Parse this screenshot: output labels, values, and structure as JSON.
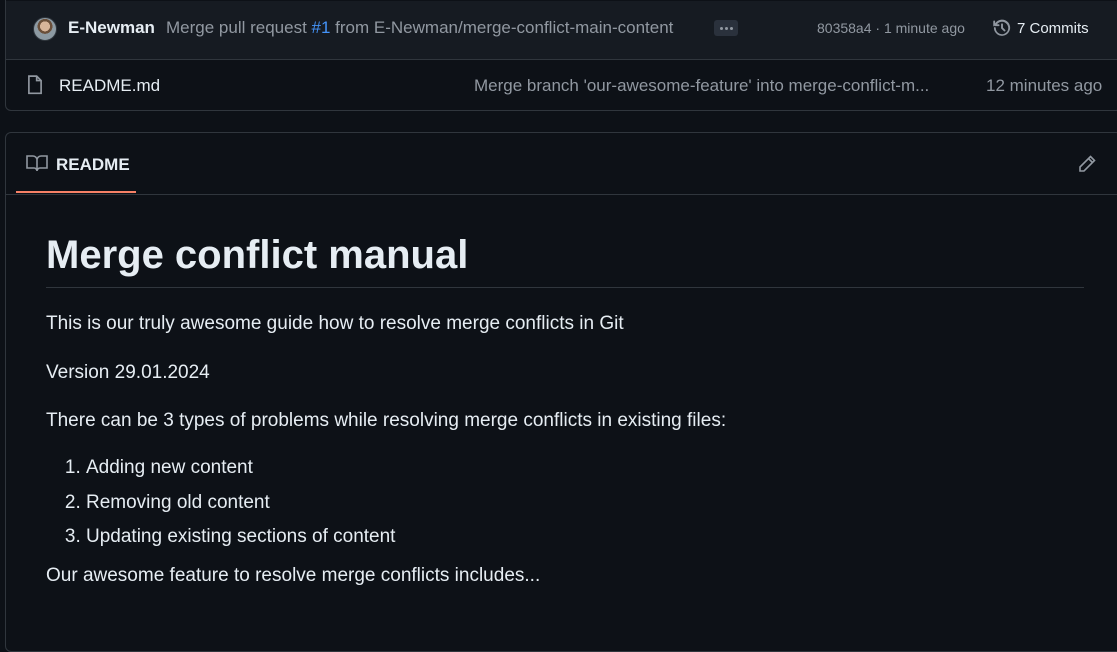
{
  "commit": {
    "author": "E-Newman",
    "message_prefix": "Merge pull request ",
    "pr_number": "#1",
    "message_suffix": " from E-Newman/merge-conflict-main-content",
    "hash_time": "80358a4 · 1 minute ago",
    "commits_label": "7 Commits"
  },
  "files": [
    {
      "name": "README.md",
      "message": "Merge branch 'our-awesome-feature' into merge-conflict-m...",
      "age": "12 minutes ago",
      "icon": "file-icon"
    }
  ],
  "readme": {
    "tab_label": "README",
    "title": "Merge conflict manual",
    "paragraphs": [
      "This is our truly awesome guide how to resolve merge conflicts in Git",
      "Version 29.01.2024",
      "There can be 3 types of problems while resolving merge conflicts in existing files:"
    ],
    "list": [
      "Adding new content",
      "Removing old content",
      "Updating existing sections of content"
    ],
    "closing": "Our awesome feature to resolve merge conflicts includes..."
  },
  "colors": {
    "background": "#0d1117",
    "panel": "#161b22",
    "border": "#30363d",
    "text": "#e6edf3",
    "muted": "#9198a1",
    "link": "#4493f8",
    "active_tab": "#f78166"
  }
}
